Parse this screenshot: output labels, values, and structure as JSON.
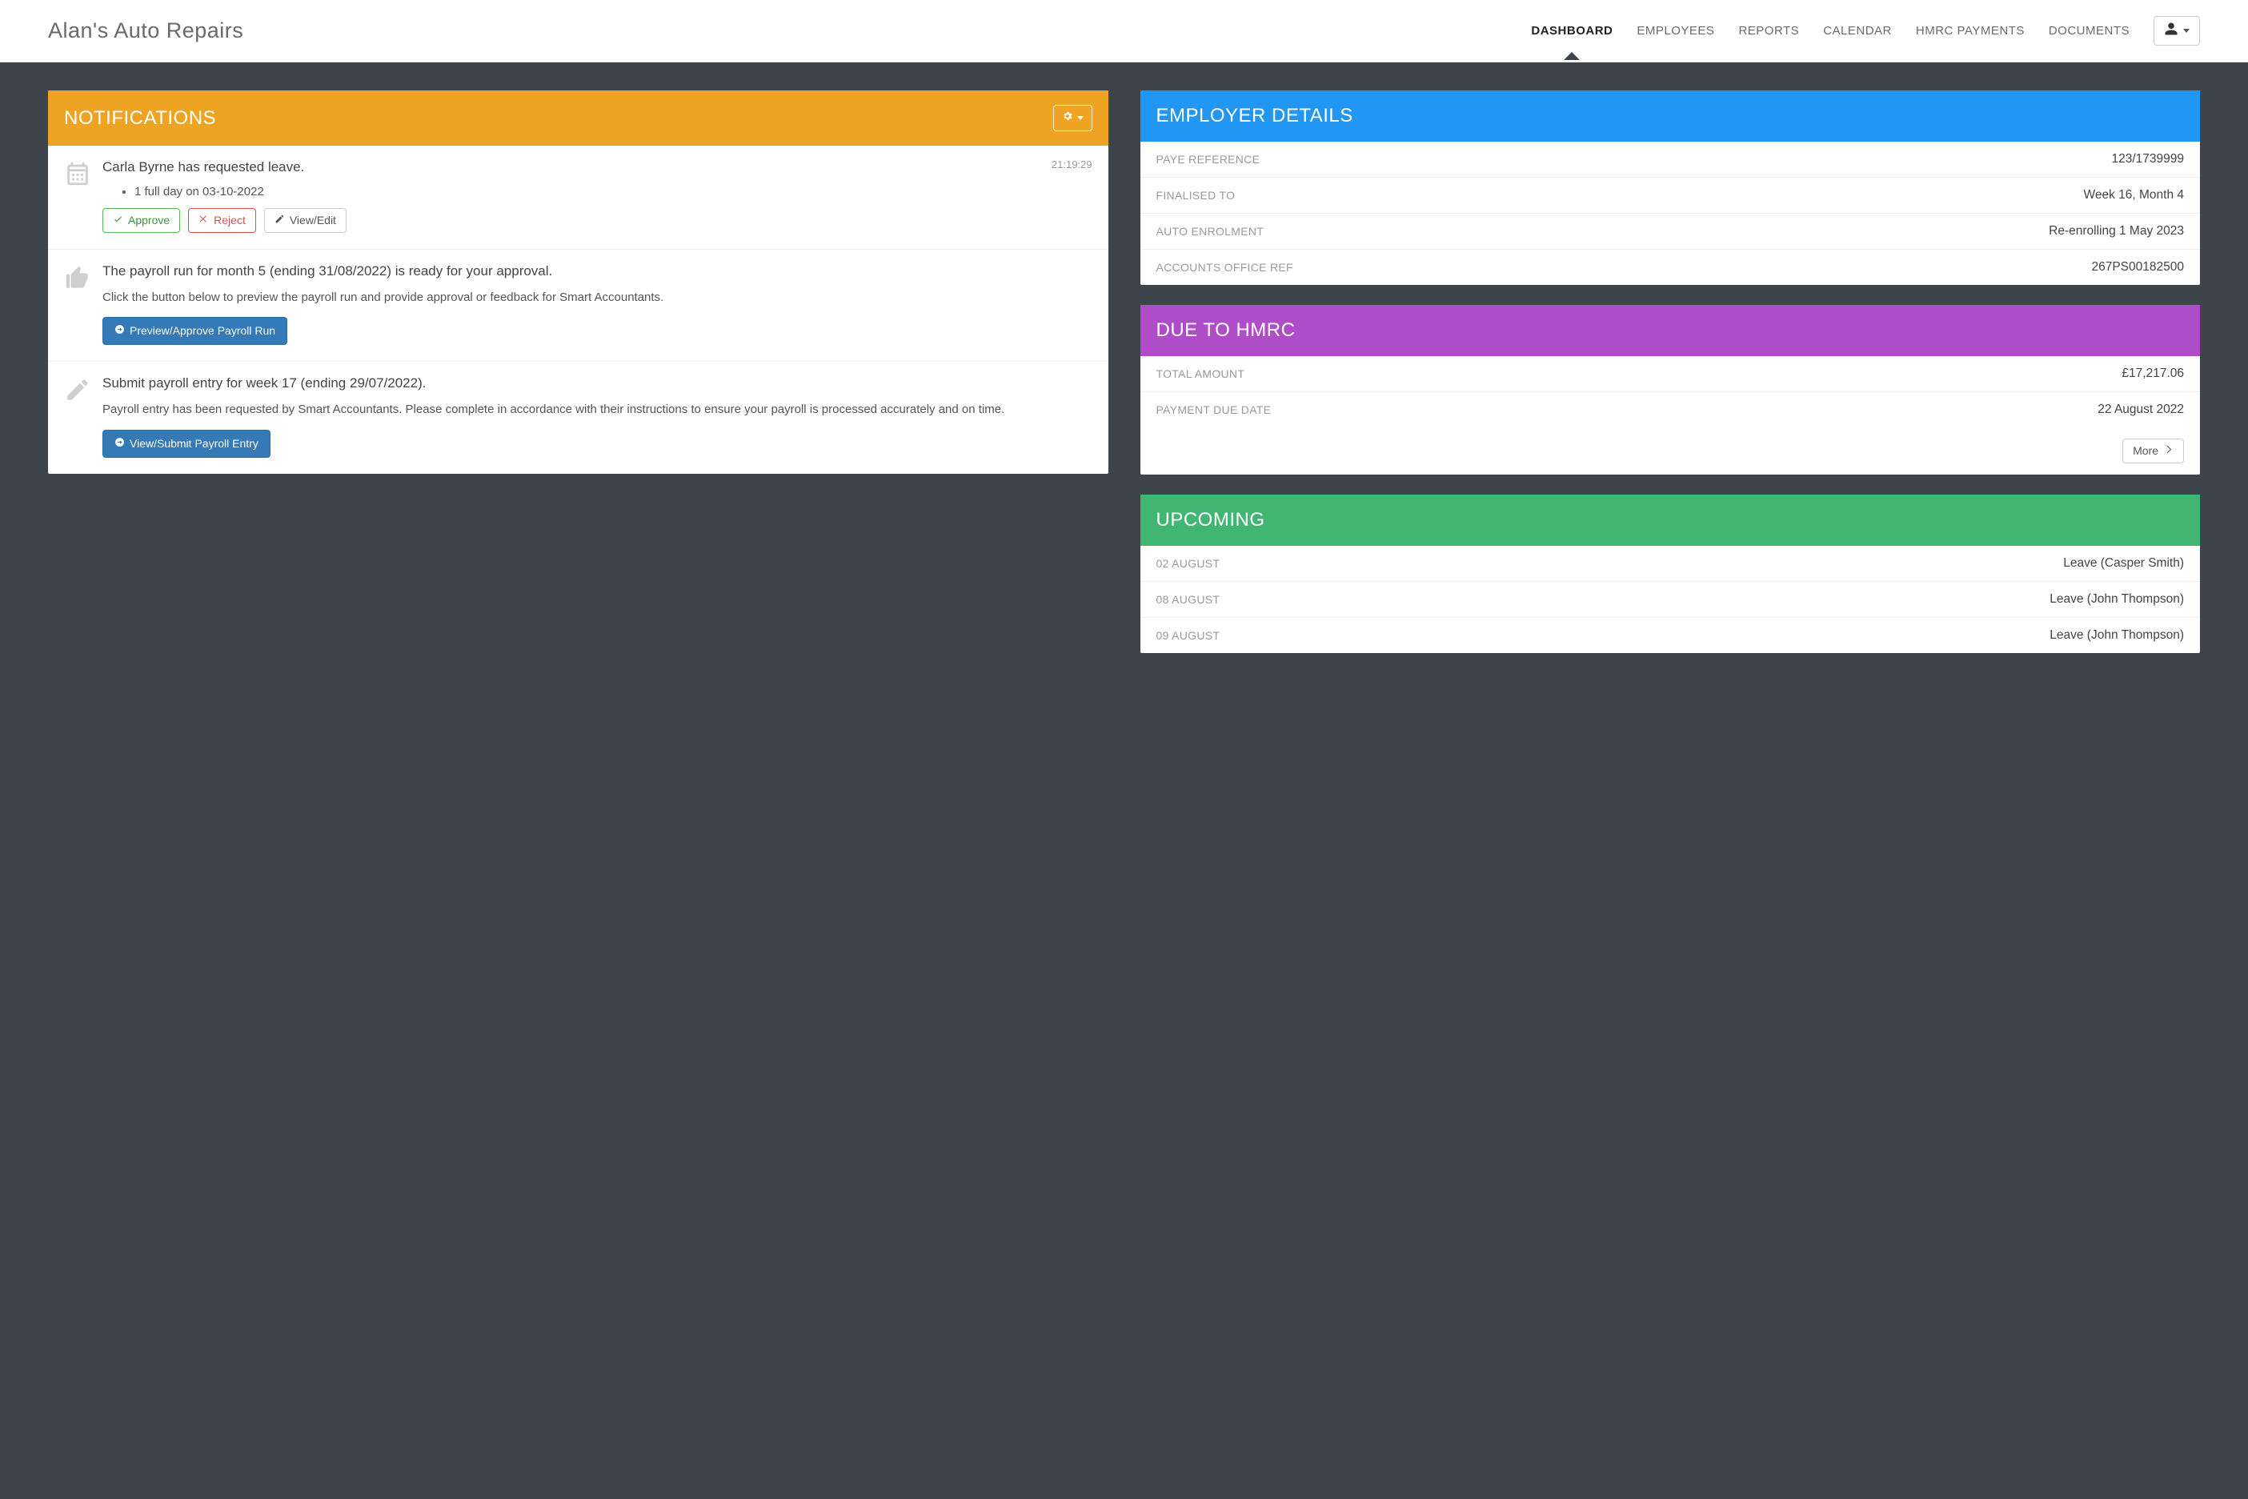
{
  "header": {
    "brand": "Alan's Auto Repairs",
    "nav": {
      "dashboard": "DASHBOARD",
      "employees": "EMPLOYEES",
      "reports": "REPORTS",
      "calendar": "CALENDAR",
      "hmrc_payments": "HMRC PAYMENTS",
      "documents": "DOCUMENTS"
    }
  },
  "notifications": {
    "title": "NOTIFICATIONS",
    "items": [
      {
        "title": "Carla Byrne has requested leave.",
        "time": "21:19:29",
        "bullet": "1 full day on 03-10-2022",
        "approve": "Approve",
        "reject": "Reject",
        "view_edit": "View/Edit"
      },
      {
        "title": "The payroll run for month 5 (ending 31/08/2022) is ready for your approval.",
        "desc": "Click the button below to preview the payroll run and provide approval or feedback for Smart Accountants.",
        "action": "Preview/Approve Payroll Run"
      },
      {
        "title": "Submit payroll entry for week 17 (ending 29/07/2022).",
        "desc": "Payroll entry has been requested by Smart Accountants. Please complete in accordance with their instructions to ensure your payroll is processed accurately and on time.",
        "action": "View/Submit Payroll Entry"
      }
    ]
  },
  "employer_details": {
    "title": "EMPLOYER DETAILS",
    "rows": [
      {
        "label": "PAYE REFERENCE",
        "value": "123/1739999"
      },
      {
        "label": "FINALISED TO",
        "value": "Week 16, Month 4"
      },
      {
        "label": "AUTO ENROLMENT",
        "value": "Re-enrolling 1 May 2023"
      },
      {
        "label": "ACCOUNTS OFFICE REF",
        "value": "267PS00182500"
      }
    ]
  },
  "due_to_hmrc": {
    "title": "DUE TO HMRC",
    "rows": [
      {
        "label": "TOTAL AMOUNT",
        "value": "£17,217.06"
      },
      {
        "label": "PAYMENT DUE DATE",
        "value": "22 August 2022"
      }
    ],
    "more": "More"
  },
  "upcoming": {
    "title": "UPCOMING",
    "rows": [
      {
        "label": "02 AUGUST",
        "value": "Leave (Casper Smith)"
      },
      {
        "label": "08 AUGUST",
        "value": "Leave (John Thompson)"
      },
      {
        "label": "09 AUGUST",
        "value": "Leave (John Thompson)"
      }
    ]
  }
}
